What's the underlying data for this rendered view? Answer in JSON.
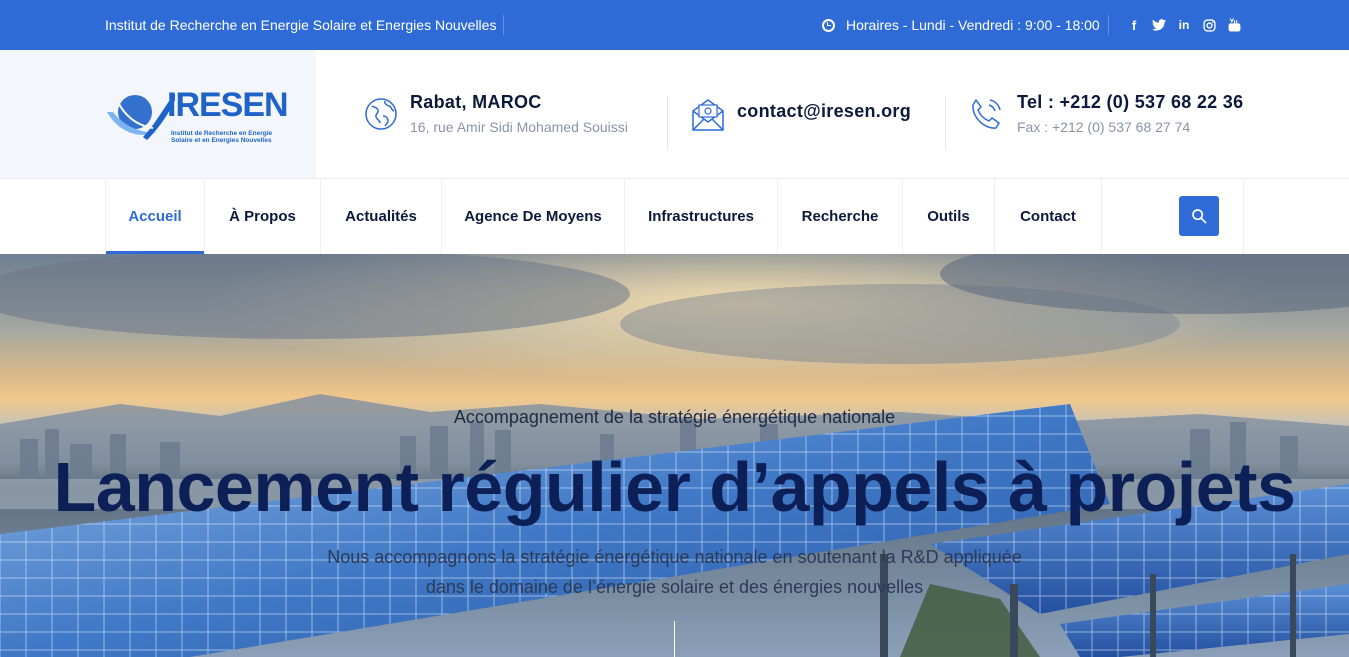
{
  "topbar": {
    "institute": "Institut de Recherche en Energie Solaire et Energies Nouvelles",
    "hours": "Horaires - Lundi - Vendredi : 9:00 - 18:00",
    "social": [
      {
        "icon": "facebook-icon",
        "glyph": "f"
      },
      {
        "icon": "twitter-icon",
        "glyph": "t"
      },
      {
        "icon": "linkedin-icon",
        "glyph": "in"
      },
      {
        "icon": "instagram-icon",
        "glyph": "◎"
      },
      {
        "icon": "youtube-icon",
        "glyph": "▶"
      }
    ],
    "bg_color": "#2f6bd6"
  },
  "logo": {
    "word": "IRESEN",
    "tag_line1": "Institut de Recherche en Energie",
    "tag_line2": "Solaire et en Energies Nouvelles"
  },
  "header": {
    "location": {
      "title": "Rabat, MAROC",
      "subtitle": "16, rue Amir Sidi Mohamed Souissi",
      "icon": "globe-icon"
    },
    "email": {
      "title": "contact@iresen.org",
      "icon": "envelope-icon"
    },
    "phone": {
      "title": "Tel : +212 (0) 537 68 22 36",
      "subtitle": "Fax : +212 (0) 537 68 27 74",
      "icon": "phone-icon"
    }
  },
  "nav": {
    "items": [
      {
        "label": "Accueil",
        "active": true
      },
      {
        "label": "À Propos"
      },
      {
        "label": "Actualités"
      },
      {
        "label": "Agence De Moyens"
      },
      {
        "label": "Infrastructures"
      },
      {
        "label": "Recherche"
      },
      {
        "label": "Outils"
      },
      {
        "label": "Contact"
      }
    ],
    "search_icon": "search-icon",
    "accent": "#2f6bd6"
  },
  "hero": {
    "kicker": "Accompagnement de la stratégie énergétique nationale",
    "headline": "Lancement régulier d’appels à projets",
    "desc_line1": "Nous accompagnons la stratégie énergétique nationale en soutenant la R&D appliquée",
    "desc_line2": "dans le domaine de l’énergie solaire et des énergies nouvelles"
  }
}
